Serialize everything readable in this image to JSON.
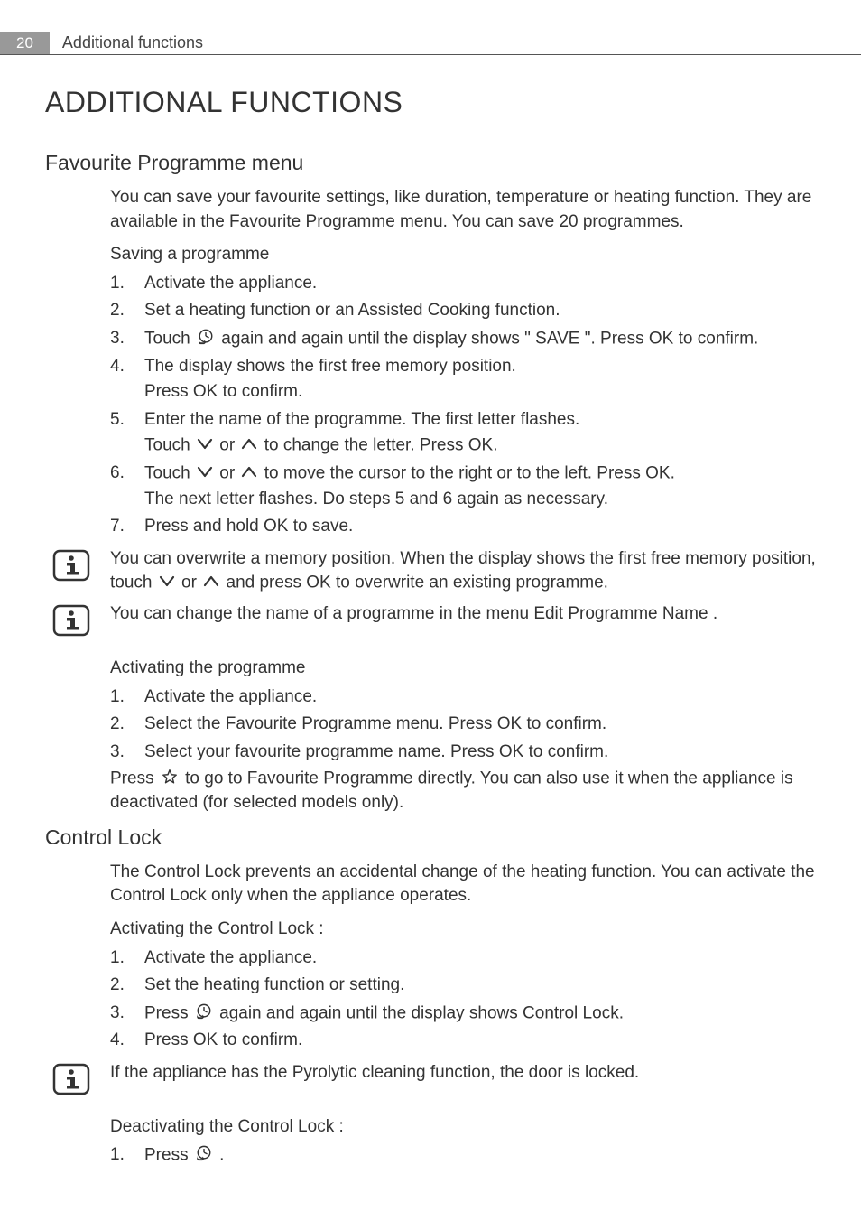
{
  "header": {
    "page_number": "20",
    "section": "Additional functions"
  },
  "h1": "ADDITIONAL FUNCTIONS",
  "sec1": {
    "title": "Favourite Programme menu",
    "intro": "You can save your favourite settings, like duration, temperature or heating function. They are available in the Favourite Programme menu. You can save 20 programmes.",
    "saving_heading": "Saving a programme",
    "steps": {
      "s1": "Activate the appliance.",
      "s2": "Set a heating function or an Assisted Cooking function.",
      "s3_a": "Touch ",
      "s3_b": " again and again until the display shows \" SAVE \". Press ",
      "s3_ok": "OK",
      "s3_c": " to confirm.",
      "s4_a": "The display shows the first free memory position.",
      "s4_b": "Press ",
      "s4_ok": "OK",
      "s4_c": " to confirm.",
      "s5_a": "Enter the name of the programme. The first letter flashes.",
      "s5_b": "Touch ",
      "s5_or": " or ",
      "s5_c": " to change the letter. Press ",
      "s5_ok": "OK",
      "s5_d": ".",
      "s6_a": "Touch ",
      "s6_or": " or ",
      "s6_b": " to move the cursor to the right or to the left. Press ",
      "s6_ok": "OK",
      "s6_c": ".",
      "s6_d": "The next letter flashes. Do steps 5 and 6 again as necessary.",
      "s7_a": "Press and hold ",
      "s7_ok": "OK",
      "s7_b": " to save."
    },
    "info1_a": "You can overwrite a memory position. When the display shows the first free memory position, touch ",
    "info1_or": " or ",
    "info1_b": " and press ",
    "info1_ok": "OK",
    "info1_c": " to overwrite an existing programme.",
    "info2": "You can change the name of a programme in the menu Edit Programme Name .",
    "activating_heading": "Activating the programme",
    "act_steps": {
      "s1": "Activate the appliance.",
      "s2_a": "Select the Favourite Programme menu. Press ",
      "s2_ok": "OK",
      "s2_b": " to confirm.",
      "s3_a": "Select your favourite programme name. Press ",
      "s3_ok": "OK",
      "s3_b": " to confirm."
    },
    "act_press_a": "Press ",
    "act_press_b": " to go to Favourite Programme directly. You can also use it when the appliance is deactivated (for selected models only)."
  },
  "sec2": {
    "title": "Control Lock",
    "intro": "The Control Lock prevents an accidental change of the heating function. You can activate the Control Lock only when the appliance operates.",
    "activating_heading": "Activating the Control Lock :",
    "steps": {
      "s1": "Activate the appliance.",
      "s2": "Set the heating function or setting.",
      "s3_a": "Press ",
      "s3_b": " again and again until the display shows Control Lock.",
      "s4_a": "Press ",
      "s4_ok": "OK",
      "s4_b": " to confirm."
    },
    "info3": "If the appliance has the Pyrolytic cleaning function, the door is locked.",
    "deactivating_heading": "Deactivating the Control Lock :",
    "deact_steps": {
      "s1_a": "Press ",
      "s1_b": " ."
    }
  }
}
